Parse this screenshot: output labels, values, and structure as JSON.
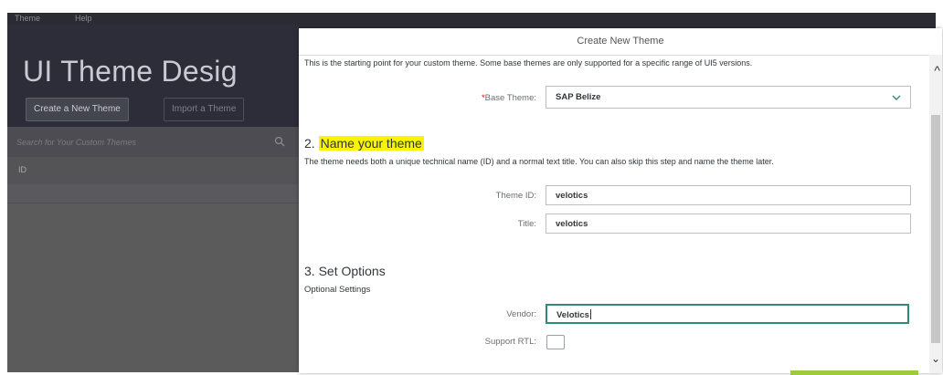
{
  "app": {
    "menu": [
      "Theme",
      "Help"
    ],
    "title": "UI Theme Desig",
    "create_button": "Create a New Theme",
    "import_button": "Import a Theme",
    "search_placeholder": "Search for Your Custom Themes",
    "list_header": "ID"
  },
  "dialog": {
    "title": "Create New Theme",
    "intro": "This is the starting point for your custom theme. Some base themes are only supported for a specific range of UI5 versions.",
    "base_theme": {
      "required_mark": "*",
      "label": "Base Theme:",
      "value": "SAP Belize"
    },
    "section2": {
      "number": "2.",
      "heading": "Name your theme",
      "description": "The theme needs both a unique technical name (ID) and a normal text title. You can also skip this step and name the theme later.",
      "theme_id_label": "Theme ID:",
      "theme_id_value": "velotics",
      "title_label": "Title:",
      "title_value": "velotics"
    },
    "section3": {
      "heading": "3. Set Options",
      "subheading": "Optional Settings",
      "vendor_label": "Vendor:",
      "vendor_value": "Velotics",
      "rtl_label": "Support RTL:",
      "rtl_checked": false
    }
  },
  "colors": {
    "highlight": "#f7f500",
    "focus_border": "#2f8a7a",
    "required": "#ee0000"
  }
}
